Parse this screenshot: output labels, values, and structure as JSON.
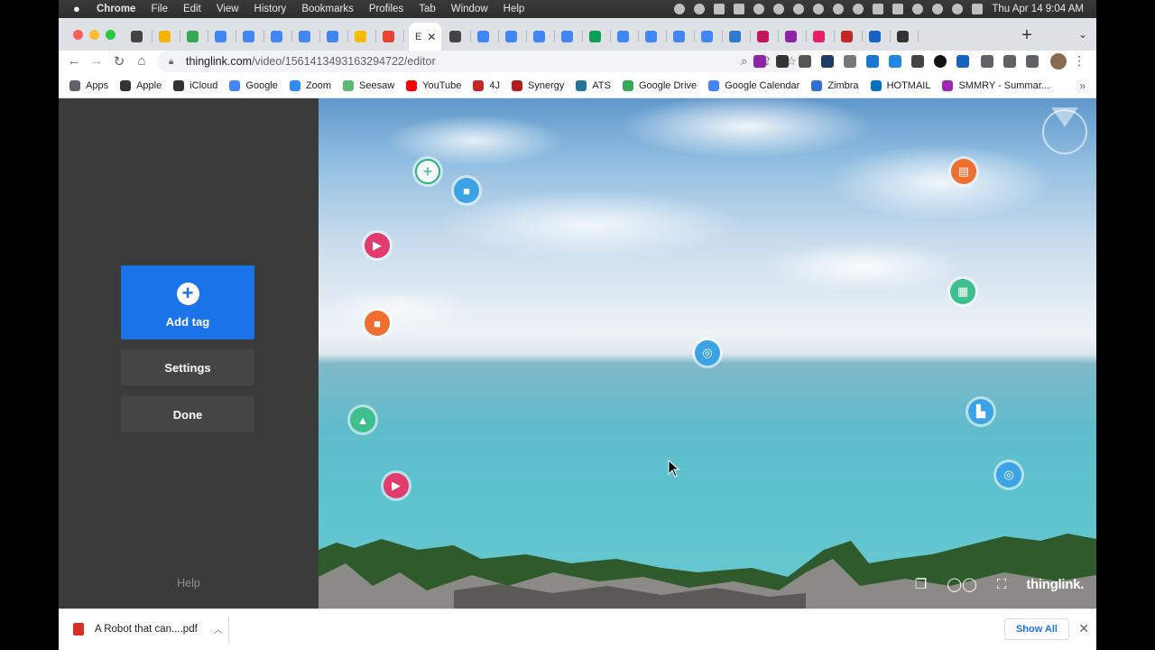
{
  "menubar": {
    "items": [
      "Chrome",
      "File",
      "Edit",
      "View",
      "History",
      "Bookmarks",
      "Profiles",
      "Tab",
      "Window",
      "Help"
    ],
    "clock": "Thu Apr 14  9:04 AM"
  },
  "tabs": {
    "active_label": "E",
    "favicons": [
      "#444444",
      "#f4b400",
      "#34a853",
      "#4285f4",
      "#4285f4",
      "#4285f4",
      "#4285f4",
      "#4285f4",
      "#fbbc05",
      "#ea4335"
    ],
    "right_favicons": [
      "#444444",
      "#4285f4",
      "#4285f4",
      "#4285f4",
      "#4285f4",
      "#0f9d58",
      "#4285f4",
      "#4285f4",
      "#4285f4",
      "#4285f4",
      "#2e7ad1",
      "#c2185b",
      "#8e24aa",
      "#e91e63",
      "#c62828",
      "#1565c0",
      "#333333"
    ]
  },
  "toolbar": {
    "url_host": "thinglink.com",
    "url_path": "/video/1561413493163294722/editor"
  },
  "bookmarks": [
    {
      "label": "Apps",
      "color": "#5f6368"
    },
    {
      "label": "Apple",
      "color": "#333333"
    },
    {
      "label": "iCloud",
      "color": "#333333"
    },
    {
      "label": "Google",
      "color": "#4285f4"
    },
    {
      "label": "Zoom",
      "color": "#2d8cff"
    },
    {
      "label": "Seesaw",
      "color": "#5bb86e"
    },
    {
      "label": "YouTube",
      "color": "#ff0000"
    },
    {
      "label": "4J",
      "color": "#c62828"
    },
    {
      "label": "Synergy",
      "color": "#b71c1c"
    },
    {
      "label": "ATS",
      "color": "#21759b"
    },
    {
      "label": "Google Drive",
      "color": "#34a853"
    },
    {
      "label": "Google Calendar",
      "color": "#4285f4"
    },
    {
      "label": "Zimbra",
      "color": "#2f6fd6"
    },
    {
      "label": "HOTMAIL",
      "color": "#0072c6"
    },
    {
      "label": "SMMRY - Summar...",
      "color": "#9c27b0"
    }
  ],
  "editor": {
    "add_tag": "Add tag",
    "settings": "Settings",
    "done": "Done",
    "help": "Help"
  },
  "hotspots": [
    {
      "icon": "plus-icon",
      "glyph": "+",
      "color": "#ffffff",
      "ring": "#2fb37a"
    },
    {
      "icon": "video-icon",
      "glyph": "■",
      "color": "#3ba3e6",
      "ring": null
    },
    {
      "icon": "play-icon",
      "glyph": "▶",
      "color": "#e23b6d",
      "ring": null
    },
    {
      "icon": "video-icon",
      "glyph": "■",
      "color": "#f06f2e",
      "ring": null
    },
    {
      "icon": "target-icon",
      "glyph": "◎",
      "color": "#3ba3e6",
      "ring": null
    },
    {
      "icon": "book-icon",
      "glyph": "▤",
      "color": "#f06f2e",
      "ring": null
    },
    {
      "icon": "grid-icon",
      "glyph": "▦",
      "color": "#3dc08e",
      "ring": null
    },
    {
      "icon": "tree-icon",
      "glyph": "▲",
      "color": "#3dc08e",
      "ring": null
    },
    {
      "icon": "building-icon",
      "glyph": "▙",
      "color": "#3ba3e6",
      "ring": null
    },
    {
      "icon": "target-icon",
      "glyph": "◎",
      "color": "#3ba3e6",
      "ring": null
    },
    {
      "icon": "play-icon",
      "glyph": "▶",
      "color": "#e23b6d",
      "ring": null
    }
  ],
  "viewer": {
    "brand": "thinglink."
  },
  "download": {
    "filename": "A Robot that can....pdf",
    "show_all": "Show All"
  }
}
